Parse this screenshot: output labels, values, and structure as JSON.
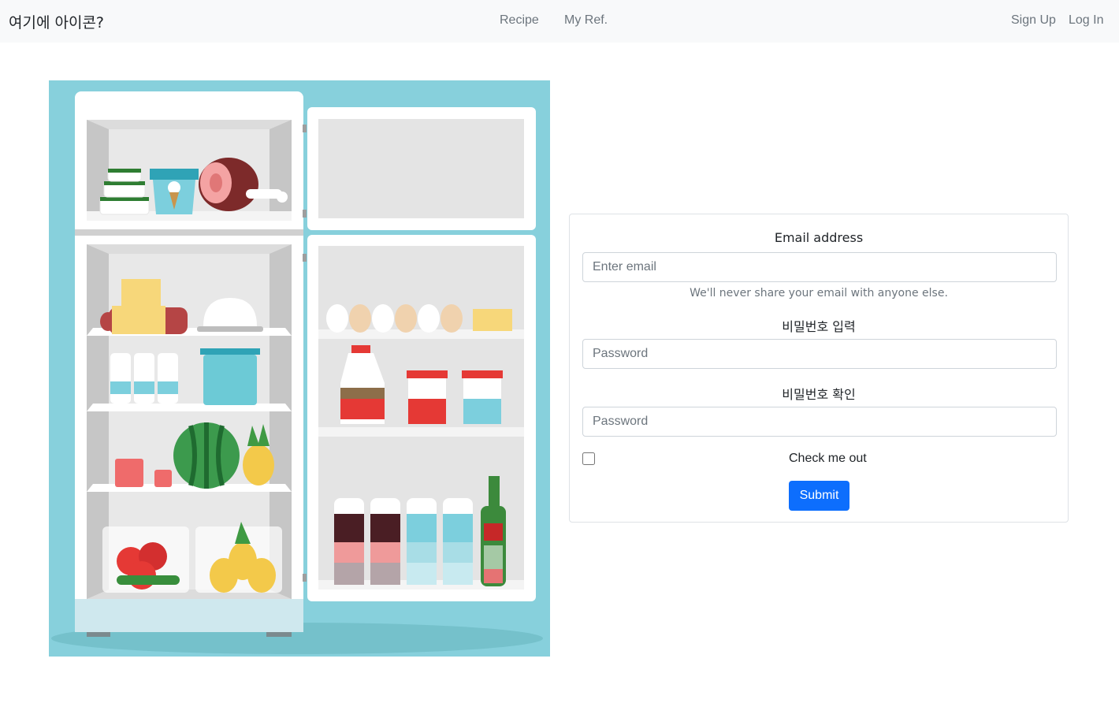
{
  "navbar": {
    "brand": "여기에 아이콘?",
    "links": [
      "Recipe",
      "My Ref."
    ],
    "auth": [
      "Sign Up",
      "Log In"
    ]
  },
  "form": {
    "email_label": "Email address",
    "email_placeholder": "Enter email",
    "email_help": "We'll never share your email with anyone else.",
    "password_label": "비밀번호 입력",
    "password_placeholder": "Password",
    "confirm_label": "비밀번호 확인",
    "confirm_placeholder": "Password",
    "remember_label": "Check me out",
    "remember_checked": false,
    "submit_label": "Submit"
  },
  "colors": {
    "navbar_bg": "#f8f9fa",
    "primary": "#0d6efd",
    "illustration_bg": "#87d0dc"
  }
}
